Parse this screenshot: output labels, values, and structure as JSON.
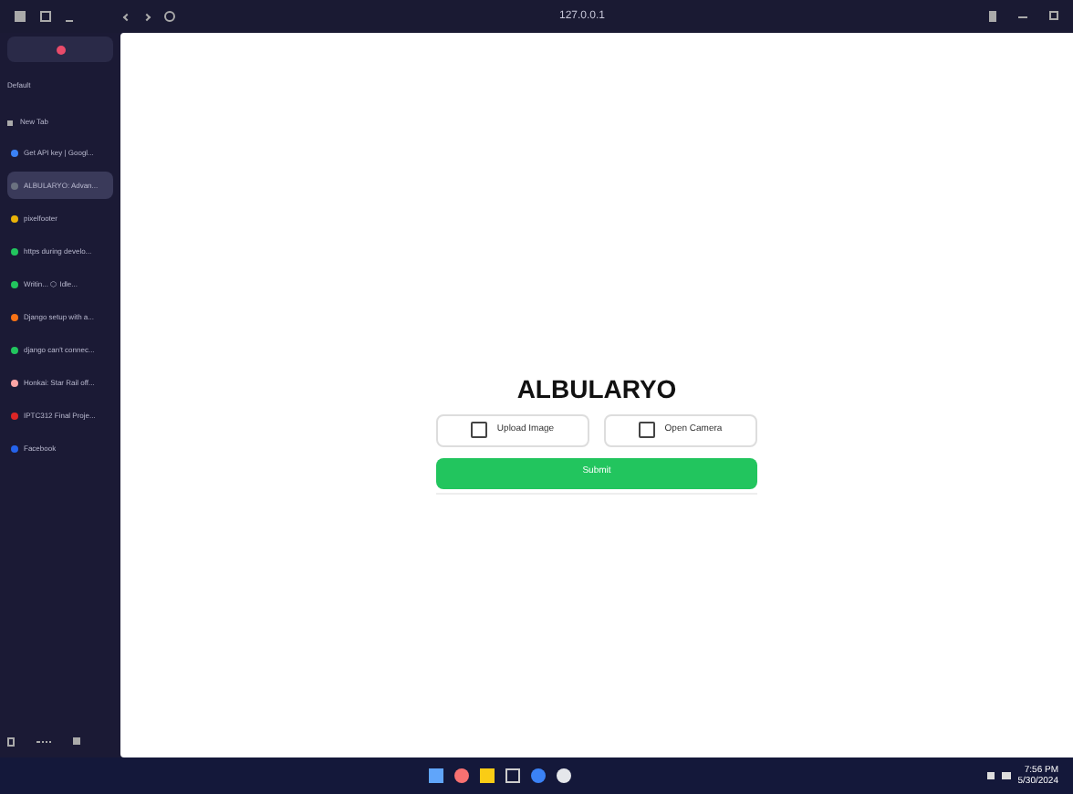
{
  "address_bar": {
    "text": "127.0.0.1"
  },
  "sidebar": {
    "profile_label": "Default",
    "new_tab": "New Tab",
    "tabs": [
      {
        "label": "Get API key | Googl...",
        "color": "#3b82f6",
        "selected": false
      },
      {
        "label": "ALBULARYO: Advan...",
        "color": "#6b7280",
        "selected": true
      },
      {
        "label": "pixelfooter",
        "color": "#eab308",
        "selected": false
      },
      {
        "label": "https during develo...",
        "color": "#22c55e",
        "selected": false
      },
      {
        "label": "Writin... ⬡ Idle...",
        "color": "#22c55e",
        "selected": false
      },
      {
        "label": "Django setup with a...",
        "color": "#f97316",
        "selected": false
      },
      {
        "label": "django can't connec...",
        "color": "#22c55e",
        "selected": false
      },
      {
        "label": "Honkai: Star Rail off...",
        "color": "#fca5a5",
        "selected": false
      },
      {
        "label": "IPTC312 Final Proje...",
        "color": "#dc2626",
        "selected": false
      },
      {
        "label": "Facebook",
        "color": "#2563eb",
        "selected": false
      }
    ]
  },
  "page": {
    "title": "ALBULARYO",
    "buttons": [
      "Upload Image",
      "Open Camera"
    ],
    "submit": "Submit"
  },
  "taskbar": {
    "time": "7:56 PM",
    "date": "5/30/2024"
  }
}
